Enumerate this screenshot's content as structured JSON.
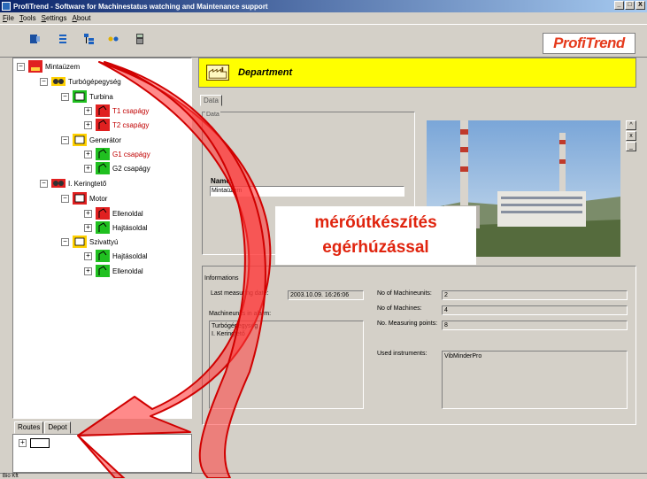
{
  "window": {
    "title": "ProfiTrend - Software for Machinestatus watching and Maintenance support",
    "controls": [
      "_",
      "□",
      "X"
    ]
  },
  "menu": [
    "File",
    "Tools",
    "Settings",
    "About"
  ],
  "logo": "ProfiTrend",
  "tree": {
    "root": "Mintaüzem",
    "n1": "Turbógépegység",
    "n1a": "Turbina",
    "n1a1": "T1 csapágy",
    "n1a2": "T2 csapágy",
    "n1b": "Generátor",
    "n1b1": "G1 csapágy",
    "n1b2": "G2 csapágy",
    "n2": "I. Keringtető",
    "n2a": "Motor",
    "n2a1": "Ellenoldal",
    "n2a2": "Hajtásoldal",
    "n2b": "Szivattyú",
    "n2b1": "Hajtásoldal",
    "n2b2": "Ellenoldal"
  },
  "bottom_tabs": [
    "Routes",
    "Depot"
  ],
  "department": {
    "title": "Department"
  },
  "data_tab": "Data",
  "data_group_label": "Data",
  "name": {
    "label": "Name:",
    "value": "Mintaüzem"
  },
  "photo_buttons": [
    "^",
    "x",
    "_"
  ],
  "info": {
    "label": "Informations",
    "last_measuring_label": "Last measuring date:",
    "last_measuring_value": "2003.10.09. 16:26:06",
    "alarm_label": "Machineunits in alarm:",
    "alarm_items": [
      "Turbógépegység",
      "I. Keringtető"
    ],
    "machineunits_label": "No of Machineunits:",
    "machineunits_value": "2",
    "machines_label": "No of Machines:",
    "machines_value": "4",
    "points_label": "No. Measuring points:",
    "points_value": "8",
    "instruments_label": "Used instruments:",
    "instruments_value": "VibMinderPro"
  },
  "caption": {
    "line1": "mérőútkészítés",
    "line2": "egérhúzással"
  },
  "status": "Bio Kft"
}
